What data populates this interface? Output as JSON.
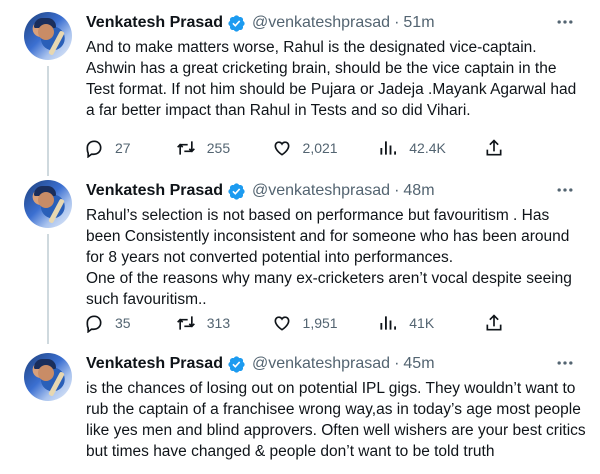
{
  "tweets": [
    {
      "name": "Venkatesh Prasad",
      "handle": "@venkateshprasad",
      "separator": "·",
      "time": "51m",
      "text": "And to make matters worse, Rahul is the designated vice-captain. Ashwin has a great cricketing brain, should be the vice captain in the Test format. If not him should be Pujara or Jadeja .Mayank Agarwal had a far better impact than Rahul in Tests and so did Vihari.",
      "replies": "27",
      "retweets": "255",
      "likes": "2,021",
      "views": "42.4K"
    },
    {
      "name": "Venkatesh Prasad",
      "handle": "@venkateshprasad",
      "separator": "·",
      "time": "48m",
      "text": "Rahul’s selection is not based on performance but favouritism . Has been Consistently inconsistent and for someone who has been around for 8 years not converted potential into performances.\nOne of the reasons why many ex-cricketers aren’t vocal despite seeing such favouritism..",
      "replies": "35",
      "retweets": "313",
      "likes": "1,951",
      "views": "41K"
    },
    {
      "name": "Venkatesh Prasad",
      "handle": "@venkateshprasad",
      "separator": "·",
      "time": "45m",
      "text": "is the chances of losing out on potential IPL gigs. They wouldn’t want to rub the captain of a franchisee wrong way,as in today’s age most people like yes men and blind approvers. Often well wishers are your best critics but times have changed & people don’t want to be told truth"
    }
  ],
  "icons": {
    "verified": "verified-badge-icon",
    "more": "more-dots-icon",
    "reply": "reply-icon",
    "retweet": "retweet-icon",
    "like": "heart-icon",
    "views": "views-icon",
    "share": "share-icon"
  },
  "colors": {
    "text": "#0f1419",
    "secondary": "#536471",
    "verified": "#1d9bf0",
    "thread_line": "#cfd9de"
  }
}
